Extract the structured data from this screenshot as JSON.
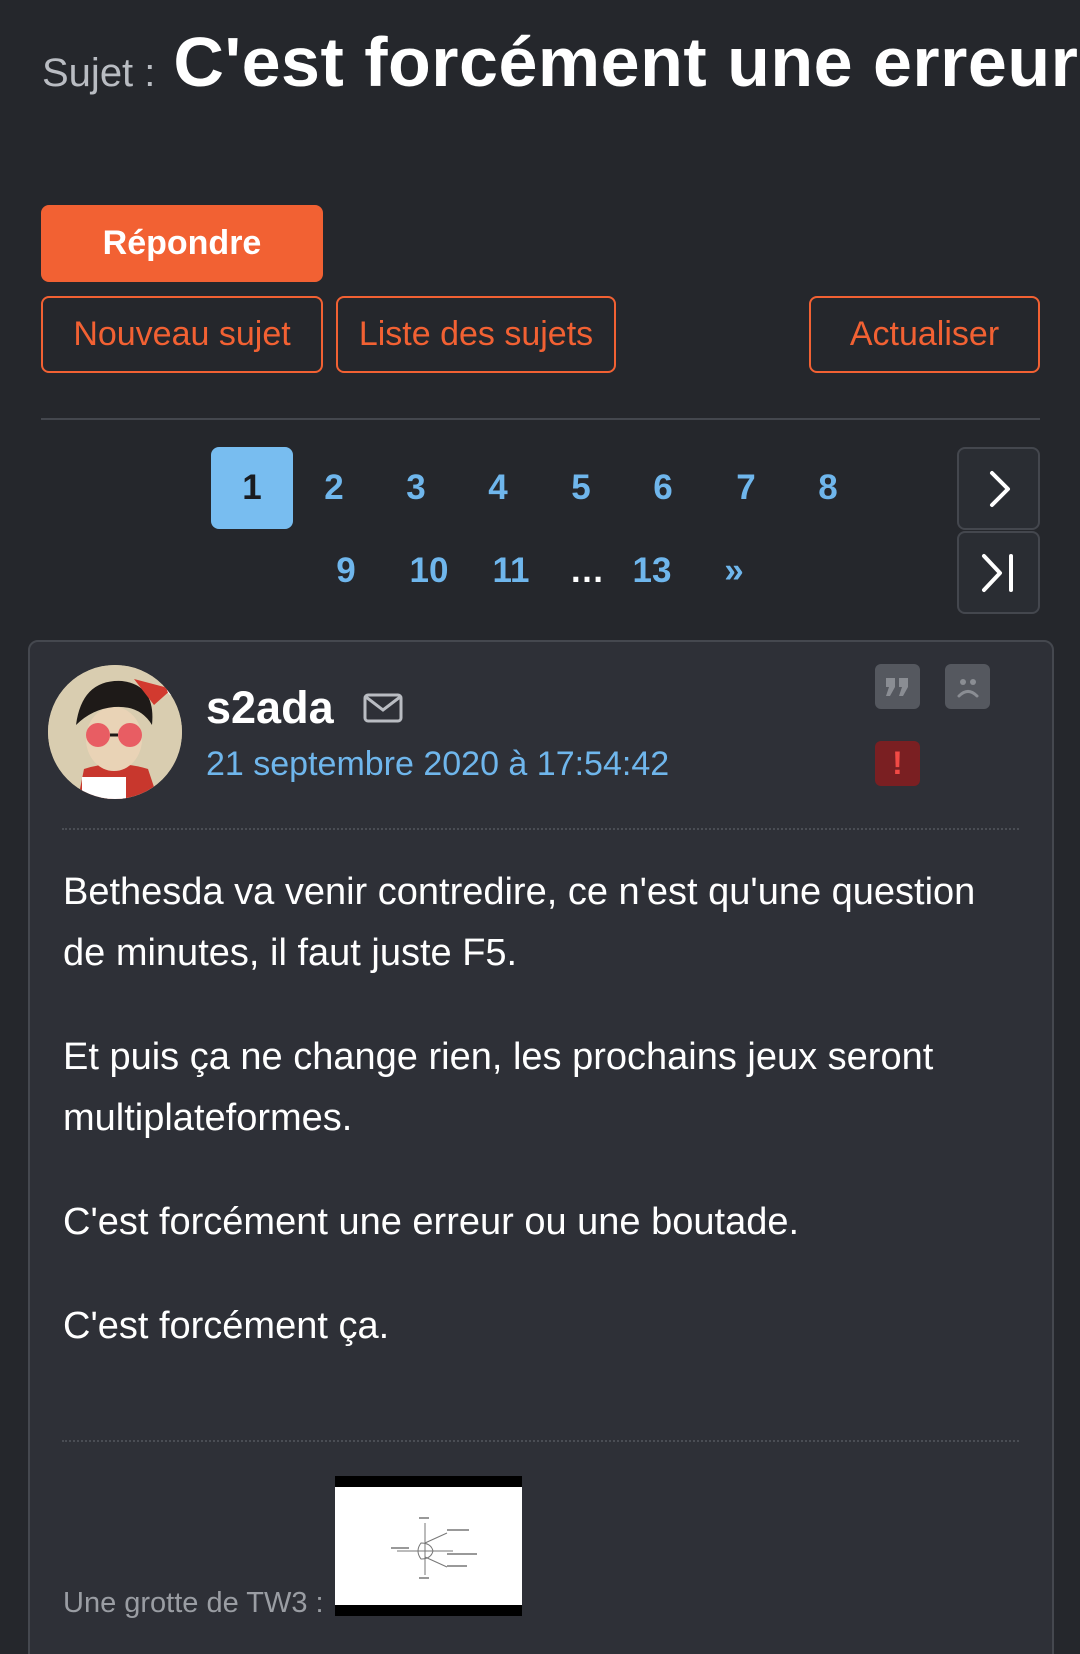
{
  "topic": {
    "prefix": "Sujet :",
    "title": "C'est forcément une erreur"
  },
  "actions": {
    "reply": "Répondre",
    "new_topic": "Nouveau sujet",
    "topic_list": "Liste des sujets",
    "refresh": "Actualiser"
  },
  "pagination": {
    "current": "1",
    "row1": [
      "1",
      "2",
      "3",
      "4",
      "5",
      "6",
      "7",
      "8"
    ],
    "row2": [
      "9",
      "10",
      "11",
      "…",
      "13",
      "»"
    ],
    "next_icon": "chevron-right-icon",
    "last_icon": "last-page-icon"
  },
  "post": {
    "author": "s2ada",
    "date": "21 septembre 2020 à 17:54:42",
    "paragraphs": [
      "Bethesda va venir contredire, ce n'est qu'une question de minutes, il faut juste F5.",
      "Et puis ça ne change rien, les prochains jeux seront multiplateformes.",
      "C'est forcément une erreur ou une boutade.",
      "C'est forcément ça."
    ],
    "signature_label": "Une grotte de TW3 :",
    "icons": [
      "mail-icon",
      "quote-icon",
      "sad-face-icon",
      "report-icon"
    ]
  },
  "colors": {
    "background": "#25272c",
    "accent": "#f26133",
    "link": "#6fb6ec",
    "card": "#2e3037",
    "alert": "#7a1f22"
  }
}
